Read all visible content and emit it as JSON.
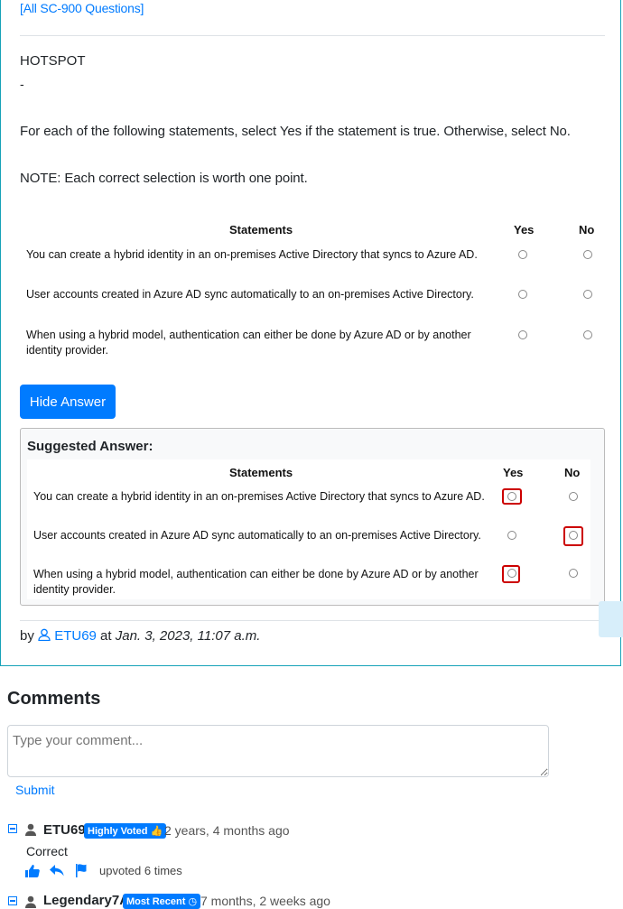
{
  "question": {
    "all_link": "[All SC-900 Questions]",
    "type": "HOTSPOT",
    "dash": "-",
    "instruction": "For each of the following statements, select Yes if the statement is true. Otherwise, select No.",
    "note": "NOTE: Each correct selection is worth one point.",
    "table": {
      "header": "Statements",
      "yes": "Yes",
      "no": "No",
      "rows": [
        "You can create a hybrid identity in an on-premises Active Directory that syncs to Azure AD.",
        "User accounts created in Azure AD sync automatically to an on-premises Active Directory.",
        "When using a hybrid model, authentication can either be done by Azure AD or by another identity provider."
      ]
    }
  },
  "answer": {
    "hide_label": "Hide Answer",
    "title": "Suggested Answer:",
    "selections": [
      "Yes",
      "No",
      "Yes"
    ]
  },
  "byline": {
    "by": "by",
    "user": "ETU69",
    "at": "at",
    "date": "Jan. 3, 2023, 11:07 a.m."
  },
  "comments": {
    "heading": "Comments",
    "placeholder": "Type your comment...",
    "submit": "Submit",
    "items": [
      {
        "user": "ETU69",
        "badge": "Highly Voted",
        "time": "2 years, 4 months ago",
        "text": "Correct",
        "upvotes": "upvoted 6 times"
      },
      {
        "user": "Legendary7A",
        "badge": "Most Recent",
        "time": "7 months, 2 weeks ago"
      }
    ]
  },
  "colors": {
    "primary": "#007bff",
    "border_accent": "#17a2b8",
    "mark": "#cc0000"
  }
}
